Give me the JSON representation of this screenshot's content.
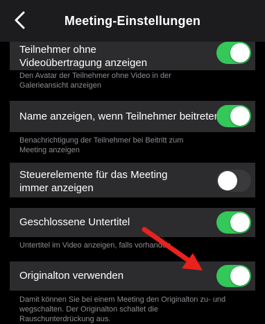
{
  "header": {
    "title": "Meeting-Einstellungen",
    "back_icon": "chevron-left-icon"
  },
  "settings": [
    {
      "label_line1": "Teilnehmer ohne",
      "label_line2": "Videoübertragung anzeigen",
      "enabled": true,
      "description_line1": "Den Avatar der Teilnehmer ohne Video in der",
      "description_line2": "Galerieansicht anzeigen"
    },
    {
      "label_line1": "Name anzeigen, wenn Teilnehmer beitreten",
      "enabled": true,
      "description_line1": "Benachrichtigung der Teilnehmer bei Beitritt zum",
      "description_line2": "Meeting anzeigen"
    },
    {
      "label_line1": "Steuerelemente für das Meeting",
      "label_line2": "immer anzeigen",
      "enabled": false
    },
    {
      "label_line1": "Geschlossene Untertitel",
      "enabled": true,
      "description_line1": "Untertitel im Video anzeigen, falls vorhanden"
    },
    {
      "label_line1": "Originalton verwenden",
      "enabled": true,
      "description_line1": "Damit können Sie bei einem Meeting den Originalton zu- und",
      "description_line2": "wegschalten. Der Originalton schaltet die",
      "description_line3": "Rauschunterdrückung aus."
    }
  ],
  "annotation": {
    "arrow_icon": "red-arrow-icon",
    "color": "#e8221c"
  },
  "colors": {
    "toggle_on": "#34c759",
    "toggle_off": "#3a3a3c",
    "row_background": "#2c2c2e",
    "description_text": "#8e8e93"
  }
}
